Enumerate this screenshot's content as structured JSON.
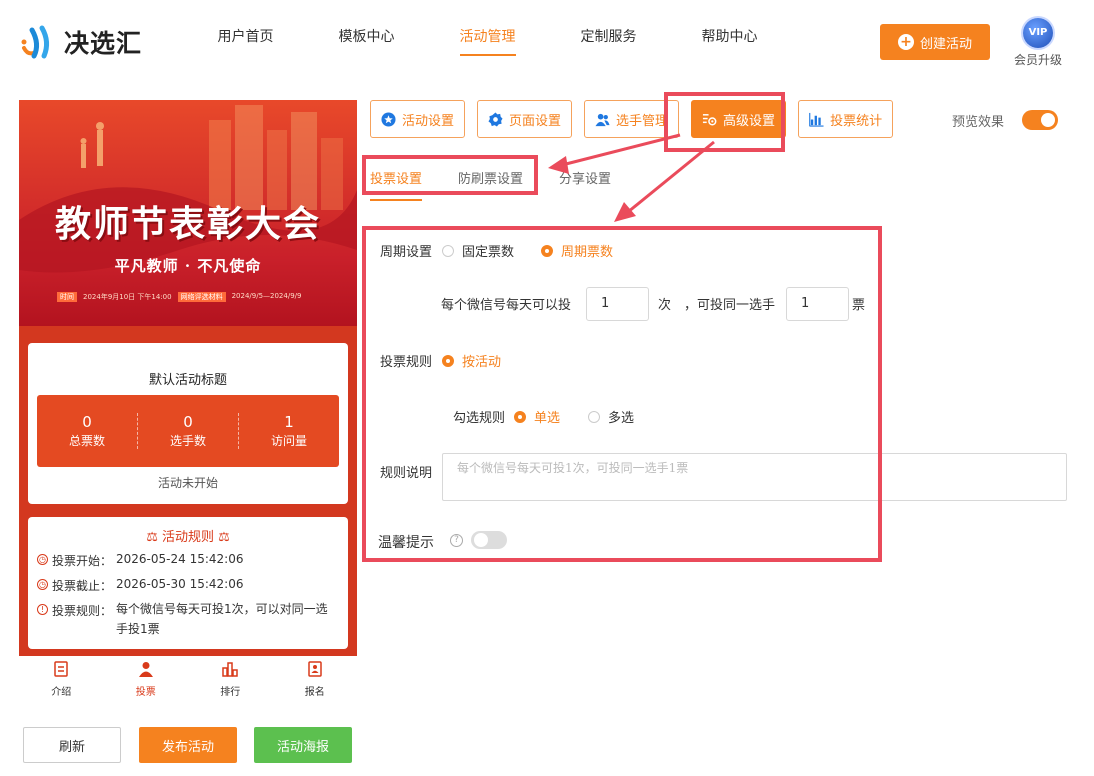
{
  "brand": {
    "name": "决选汇"
  },
  "nav": {
    "items": [
      {
        "label": "用户首页",
        "active": false
      },
      {
        "label": "模板中心",
        "active": false
      },
      {
        "label": "活动管理",
        "active": true
      },
      {
        "label": "定制服务",
        "active": false
      },
      {
        "label": "帮助中心",
        "active": false
      }
    ],
    "create_label": "创建活动",
    "vip_badge": "VIP",
    "vip_label": "会员升级"
  },
  "preview_phone": {
    "banner_title": "教师节表彰大会",
    "banner_subtitle": "平凡教师 · 不凡使命",
    "meta_time_tag": "时间",
    "meta_time": "2024年9月10日 下午14:00",
    "meta_vote_tag": "网络评选材料",
    "meta_vote": "2024/9/5—2024/9/9",
    "activity_title": "默认活动标题",
    "stats": [
      {
        "value": "0",
        "label": "总票数"
      },
      {
        "value": "0",
        "label": "选手数"
      },
      {
        "value": "1",
        "label": "访问量"
      }
    ],
    "status": "活动未开始",
    "rules_title": "活动规则",
    "rules": [
      {
        "label": "投票开始：",
        "value": "2026-05-24 15:42:06"
      },
      {
        "label": "投票截止：",
        "value": "2026-05-30 15:42:06"
      },
      {
        "label": "投票规则：",
        "value": "每个微信号每天可投1次，可以对同一选手投1票"
      }
    ],
    "tabbar": [
      {
        "label": "介绍",
        "icon": "intro-icon",
        "active": false
      },
      {
        "label": "投票",
        "icon": "user-icon",
        "active": true
      },
      {
        "label": "排行",
        "icon": "ranking-icon",
        "active": false
      },
      {
        "label": "报名",
        "icon": "signup-icon",
        "active": false
      }
    ]
  },
  "bottom_buttons": {
    "refresh": "刷新",
    "publish": "发布活动",
    "poster": "活动海报"
  },
  "toolbar": {
    "buttons": [
      {
        "label": "活动设置",
        "icon": "star-icon",
        "active": false
      },
      {
        "label": "页面设置",
        "icon": "gear-icon",
        "active": false
      },
      {
        "label": "选手管理",
        "icon": "users-icon",
        "active": false
      },
      {
        "label": "高级设置",
        "icon": "settings-icon",
        "active": true
      },
      {
        "label": "投票统计",
        "icon": "chart-icon",
        "active": false
      }
    ],
    "preview_label": "预览效果",
    "preview_on": true
  },
  "subtabs": [
    {
      "label": "投票设置",
      "active": true
    },
    {
      "label": "防刷票设置",
      "active": false
    },
    {
      "label": "分享设置",
      "active": false
    }
  ],
  "form": {
    "cycle_label": "周期设置",
    "cycle_options": [
      {
        "label": "固定票数",
        "selected": false
      },
      {
        "label": "周期票数",
        "selected": true
      }
    ],
    "per_account_prefix": "每个微信号每天可以投",
    "per_account_value": "1",
    "per_account_unit": "次",
    "same_player_prefix": "，可投同一选手",
    "same_player_value": "1",
    "same_player_unit": "票",
    "rule_label": "投票规则",
    "rule_option": "按活动",
    "select_label": "勾选规则",
    "select_options": [
      {
        "label": "单选",
        "selected": true
      },
      {
        "label": "多选",
        "selected": false
      }
    ],
    "desc_label": "规则说明",
    "desc_placeholder": "每个微信号每天可投1次，可投同一选手1票",
    "tip_label": "温馨提示",
    "tip_help": "?",
    "tip_on": false
  },
  "colors": {
    "accent": "#f5821f",
    "highlight": "#ea4b5b",
    "banner": "#d3381f",
    "poster_green": "#5cc04f"
  }
}
